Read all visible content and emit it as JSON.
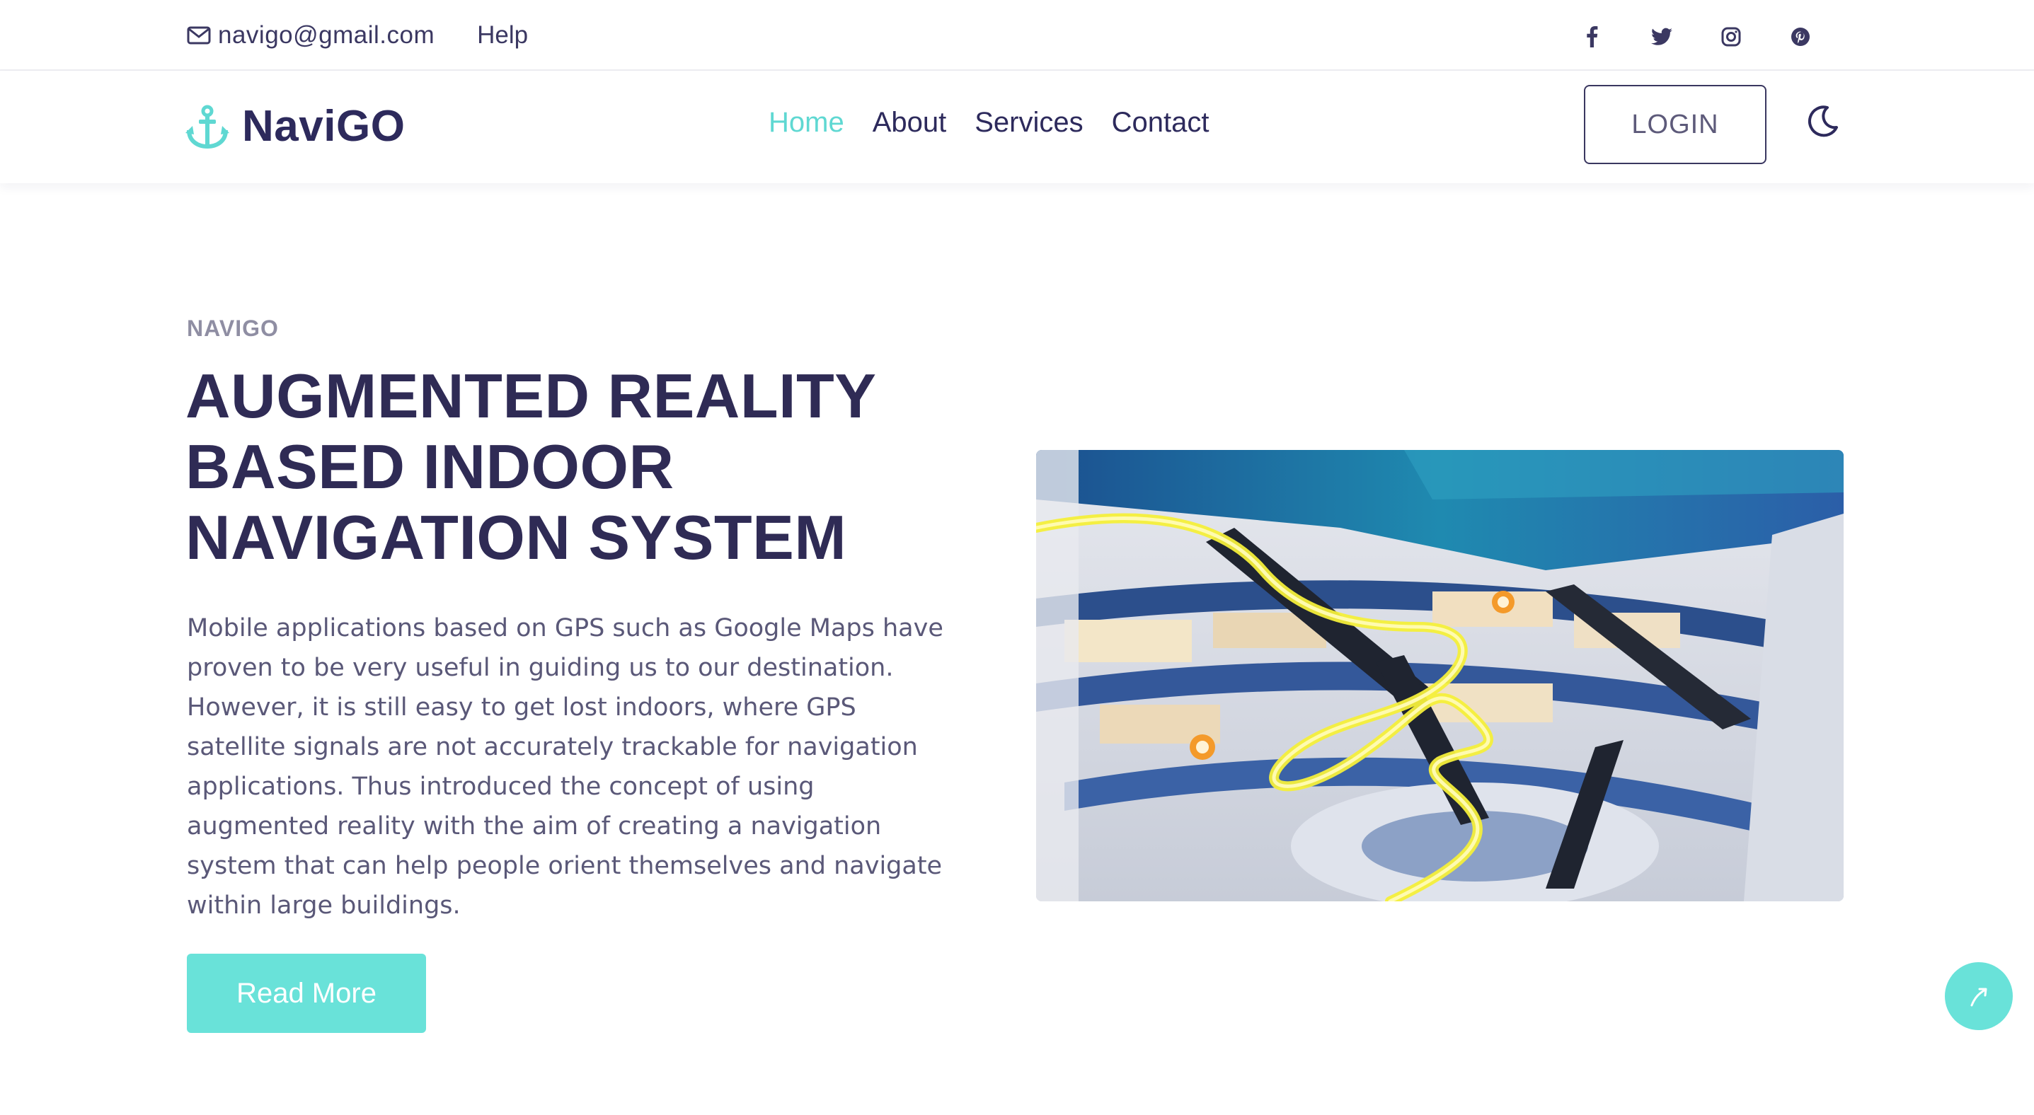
{
  "topbar": {
    "email": "navigo@gmail.com",
    "help": "Help",
    "social_icons": [
      "facebook-icon",
      "twitter-icon",
      "instagram-icon",
      "pinterest-icon"
    ]
  },
  "navbar": {
    "brand": "NaviGO",
    "menu": [
      "Home",
      "About",
      "Services",
      "Contact"
    ],
    "active_menu": "Home",
    "login": "LOGIN",
    "theme_toggle_icon": "moon-icon"
  },
  "hero": {
    "eyebrow": "NAVIGO",
    "title_lines": [
      "AUGMENTED REALITY",
      "BASED INDOOR",
      "NAVIGATION SYSTEM"
    ],
    "description": "Mobile applications based on GPS such as Google Maps have proven to be very useful in guiding us to our destination. However, it is still easy to get lost indoors, where GPS satellite signals are not accurately trackable for navigation applications. Thus introduced the concept of using augmented reality with the aim of creating a navigation system that can help people orient themselves and navigate within large buildings.",
    "cta": "Read More"
  },
  "colors": {
    "accent": "#69e2d9",
    "active_link": "#5fd8d2",
    "heading": "#2f2b55",
    "body_text": "#5a5878"
  },
  "scroll_top_icon": "arrow-up-icon"
}
